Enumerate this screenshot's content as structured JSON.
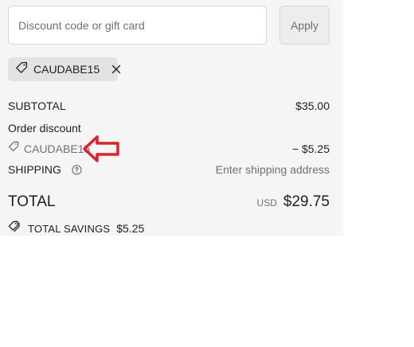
{
  "discount": {
    "placeholder": "Discount code or gift card",
    "apply_label": "Apply"
  },
  "applied_code": {
    "code": "CAUDABE15",
    "tag_icon": "tag-icon",
    "remove_icon": "close-icon"
  },
  "summary": {
    "subtotal_label": "SUBTOTAL",
    "subtotal_value": "$35.00",
    "order_discount_label": "Order discount",
    "discount_code": "CAUDABE15",
    "discount_value": "− $5.25",
    "shipping_label": "SHIPPING",
    "shipping_value": "Enter shipping address",
    "total_label": "TOTAL",
    "currency": "USD",
    "total_value": "$29.75",
    "savings_label": "TOTAL SAVINGS",
    "savings_value": "$5.25"
  },
  "colors": {
    "panel_bg": "#f5f5f5",
    "arrow": "#e0202a"
  }
}
